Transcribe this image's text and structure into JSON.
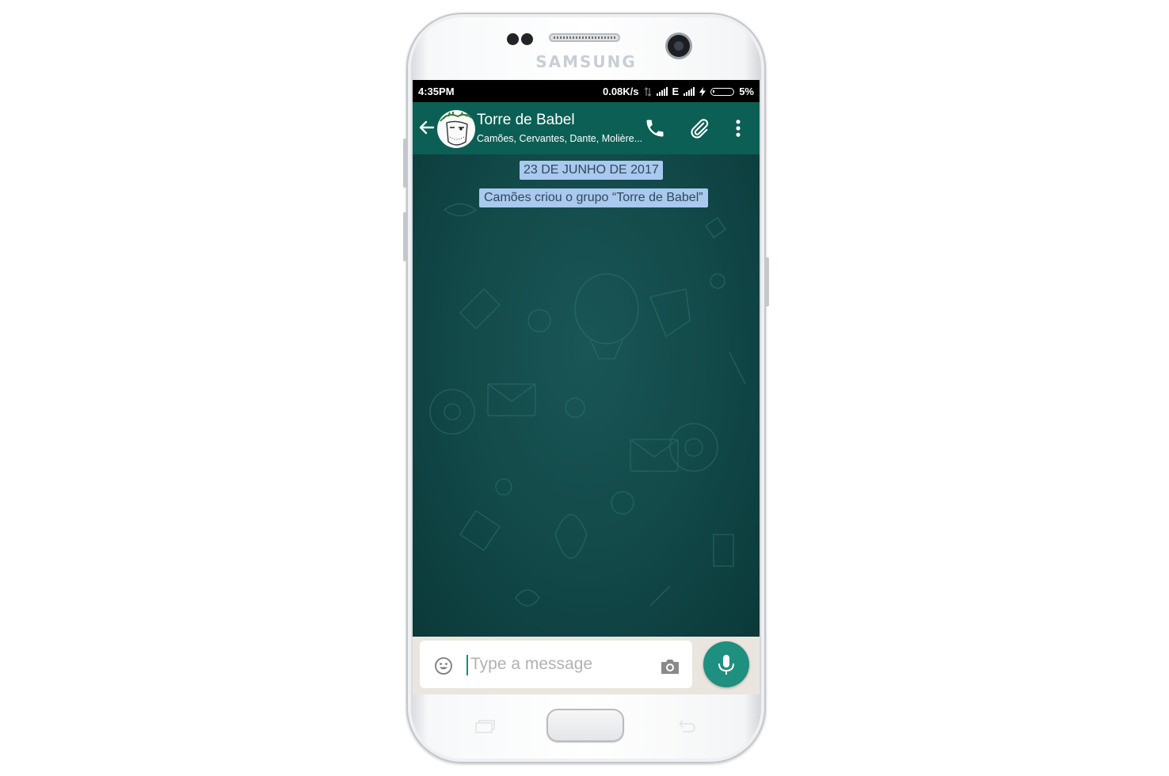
{
  "device": {
    "brand": "SAMSUNG"
  },
  "status_bar": {
    "time": "4:35PM",
    "speed": "0.08K/s",
    "network_type": "E",
    "battery": "5%"
  },
  "header": {
    "title": "Torre de Babel",
    "subtitle": "Camões, Cervantes, Dante, Molière..."
  },
  "chat": {
    "date_chip": "23 DE JUNHO DE 2017",
    "system_message": "Camões criou o grupo “Torre de Babel”"
  },
  "composer": {
    "placeholder": "Type a message",
    "value": ""
  },
  "colors": {
    "header": "#0b5f55",
    "wallpaper": "#124848",
    "chip_bg": "#a9c9ee",
    "mic_button": "#1f8f7f"
  },
  "icons": [
    "back-arrow-icon",
    "phone-icon",
    "paperclip-icon",
    "more-vert-icon",
    "emoji-icon",
    "camera-icon",
    "mic-icon"
  ]
}
